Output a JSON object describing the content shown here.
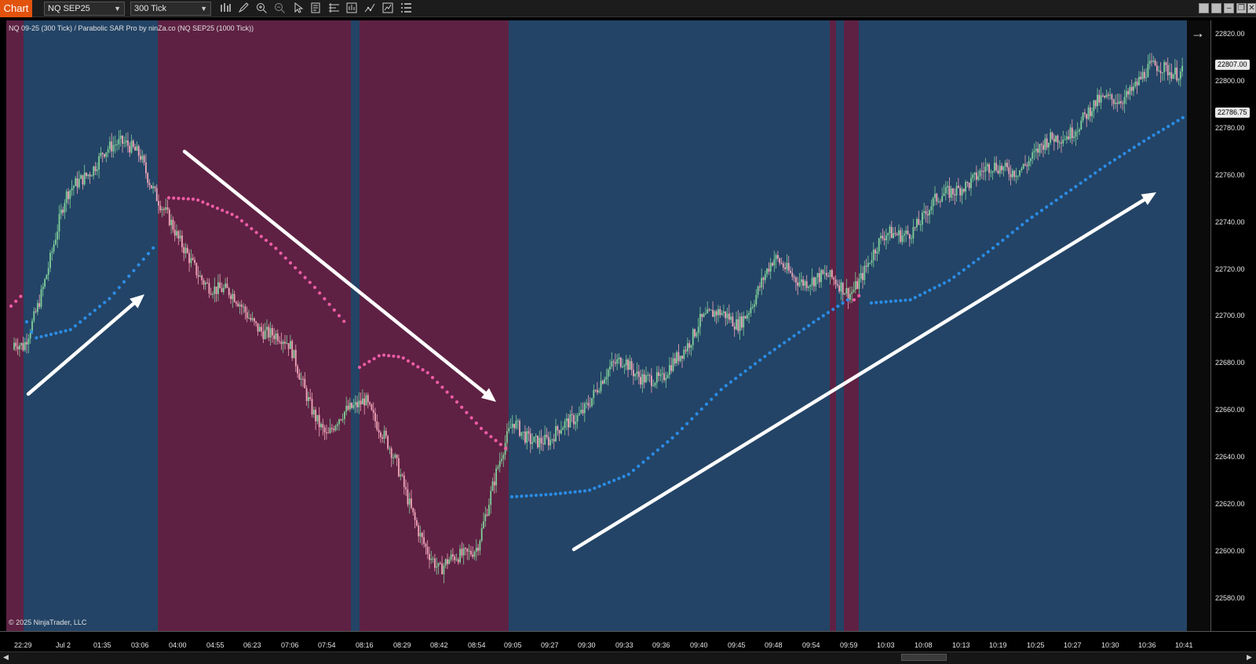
{
  "toolbar": {
    "chart_tab": "Chart",
    "instrument": "NQ SEP25",
    "interval": "300 Tick",
    "icons": [
      "bars-icon",
      "draw-pencil-icon",
      "zoom-in-icon",
      "zoom-out-icon",
      "pointer-icon",
      "data-box-icon",
      "drawing-tools-icon",
      "chart-trader-icon",
      "strategies-icon",
      "indicators-icon",
      "properties-icon"
    ]
  },
  "chart": {
    "title": "NQ 09-25 (300 Tick) / Parabolic SAR Pro by ninZa.co (NQ SEP25 (1000 Tick))",
    "copyright": "© 2025 NinjaTrader, LLC",
    "colors": {
      "bull_zone": "#234466",
      "bear_zone": "#5e2143",
      "sar_up": "#2b8ce6",
      "sar_down": "#ee5ca6",
      "candle_up": "#7fcf9a",
      "candle_down": "#f1a5b8",
      "arrow": "#ffffff"
    },
    "annotation_arrows": [
      "up",
      "down",
      "up"
    ]
  },
  "price_axis": {
    "labels": [
      "22820.00",
      "22800.00",
      "22780.00",
      "22760.00",
      "22740.00",
      "22720.00",
      "22700.00",
      "22680.00",
      "22660.00",
      "22640.00",
      "22620.00",
      "22600.00",
      "22580.00"
    ],
    "current_price": "22807.00",
    "sar_price": "22786.75"
  },
  "time_axis": {
    "labels": [
      "22:29",
      "Jul 2",
      "01:35",
      "03:06",
      "04:00",
      "04:55",
      "06:23",
      "07:06",
      "07:54",
      "08:16",
      "08:29",
      "08:42",
      "08:54",
      "09:05",
      "09:27",
      "09:30",
      "09:33",
      "09:36",
      "09:40",
      "09:45",
      "09:48",
      "09:54",
      "09:59",
      "10:03",
      "10:08",
      "10:13",
      "10:19",
      "10:25",
      "10:27",
      "10:30",
      "10:36",
      "10:41"
    ]
  },
  "chart_data": {
    "type": "candlestick",
    "instrument": "NQ 09-25",
    "ylim": [
      22575,
      22826
    ],
    "regimes": [
      {
        "trend": "bear",
        "from": "22:29",
        "to": "22:29"
      },
      {
        "trend": "bull",
        "from": "22:29",
        "to": "03:06"
      },
      {
        "trend": "bear",
        "from": "03:06",
        "to": "08:16"
      },
      {
        "trend": "bull",
        "from": "08:16",
        "to": "08:16"
      },
      {
        "trend": "bear",
        "from": "08:16",
        "to": "09:05"
      },
      {
        "trend": "bull",
        "from": "09:05",
        "to": "09:54"
      },
      {
        "trend": "bear",
        "from": "09:54",
        "to": "09:54"
      },
      {
        "trend": "bull",
        "from": "09:54",
        "to": "09:59"
      },
      {
        "trend": "bear",
        "from": "09:59",
        "to": "09:59"
      },
      {
        "trend": "bull",
        "from": "09:59",
        "to": "10:41"
      }
    ],
    "price_path": [
      {
        "t": "22:29",
        "price": 22686
      },
      {
        "t": "Jul 2",
        "price": 22748
      },
      {
        "t": "01:35",
        "price": 22772
      },
      {
        "t": "03:06",
        "price": 22770
      },
      {
        "t": "04:00",
        "price": 22730
      },
      {
        "t": "04:55",
        "price": 22712
      },
      {
        "t": "06:23",
        "price": 22700
      },
      {
        "t": "07:06",
        "price": 22685
      },
      {
        "t": "07:54",
        "price": 22648
      },
      {
        "t": "08:16",
        "price": 22668
      },
      {
        "t": "08:29",
        "price": 22628
      },
      {
        "t": "08:42",
        "price": 22590
      },
      {
        "t": "08:54",
        "price": 22605
      },
      {
        "t": "09:05",
        "price": 22655
      },
      {
        "t": "09:27",
        "price": 22645
      },
      {
        "t": "09:30",
        "price": 22665
      },
      {
        "t": "09:33",
        "price": 22682
      },
      {
        "t": "09:36",
        "price": 22670
      },
      {
        "t": "09:40",
        "price": 22700
      },
      {
        "t": "09:45",
        "price": 22698
      },
      {
        "t": "09:48",
        "price": 22722
      },
      {
        "t": "09:54",
        "price": 22716
      },
      {
        "t": "09:59",
        "price": 22712
      },
      {
        "t": "10:03",
        "price": 22733
      },
      {
        "t": "10:08",
        "price": 22742
      },
      {
        "t": "10:13",
        "price": 22758
      },
      {
        "t": "10:19",
        "price": 22762
      },
      {
        "t": "10:25",
        "price": 22768
      },
      {
        "t": "10:27",
        "price": 22782
      },
      {
        "t": "10:30",
        "price": 22792
      },
      {
        "t": "10:36",
        "price": 22803
      },
      {
        "t": "10:41",
        "price": 22807
      }
    ]
  }
}
